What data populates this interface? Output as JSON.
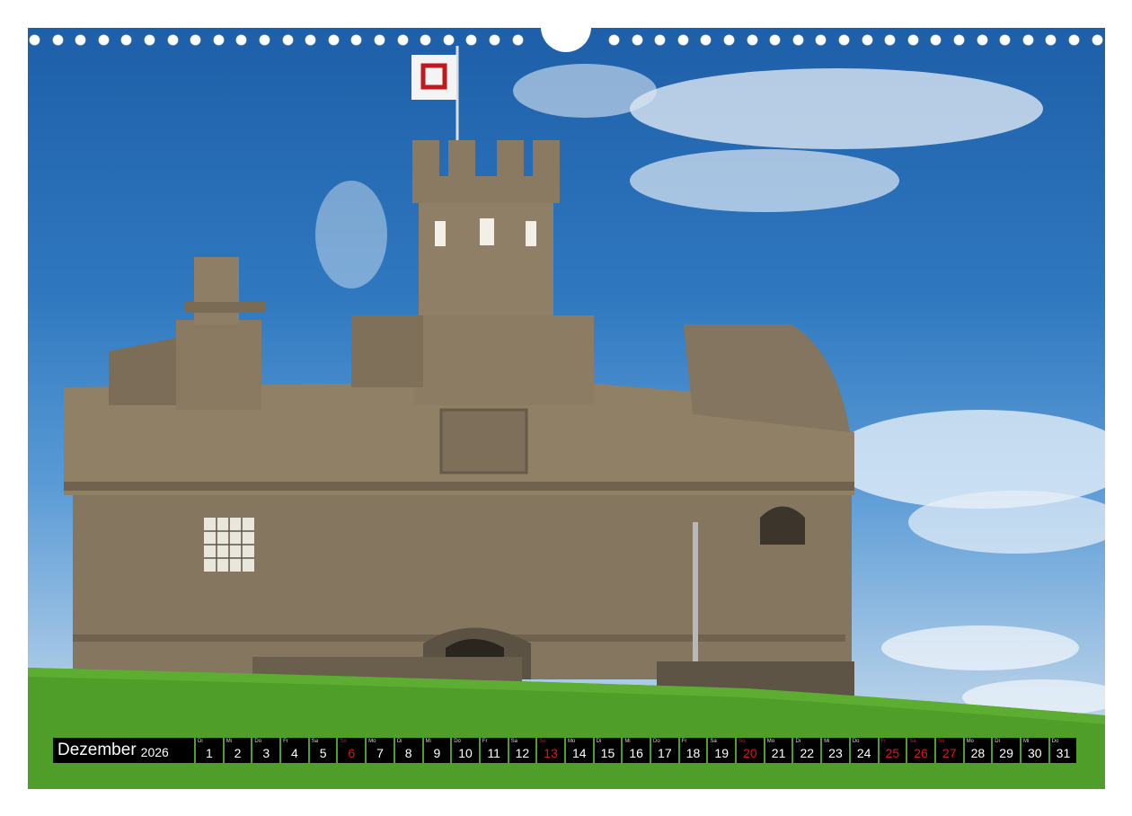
{
  "calendar": {
    "month": "Dezember",
    "year": "2026",
    "days": [
      {
        "wd": "Di",
        "n": "1",
        "we": false
      },
      {
        "wd": "Mi",
        "n": "2",
        "we": false
      },
      {
        "wd": "Do",
        "n": "3",
        "we": false
      },
      {
        "wd": "Fr",
        "n": "4",
        "we": false
      },
      {
        "wd": "Sa",
        "n": "5",
        "we": false
      },
      {
        "wd": "So",
        "n": "6",
        "we": true
      },
      {
        "wd": "Mo",
        "n": "7",
        "we": false
      },
      {
        "wd": "Di",
        "n": "8",
        "we": false
      },
      {
        "wd": "Mi",
        "n": "9",
        "we": false
      },
      {
        "wd": "Do",
        "n": "10",
        "we": false
      },
      {
        "wd": "Fr",
        "n": "11",
        "we": false
      },
      {
        "wd": "Sa",
        "n": "12",
        "we": false
      },
      {
        "wd": "So",
        "n": "13",
        "we": true
      },
      {
        "wd": "Mo",
        "n": "14",
        "we": false
      },
      {
        "wd": "Di",
        "n": "15",
        "we": false
      },
      {
        "wd": "Mi",
        "n": "16",
        "we": false
      },
      {
        "wd": "Do",
        "n": "17",
        "we": false
      },
      {
        "wd": "Fr",
        "n": "18",
        "we": false
      },
      {
        "wd": "Sa",
        "n": "19",
        "we": false
      },
      {
        "wd": "So",
        "n": "20",
        "we": true
      },
      {
        "wd": "Mo",
        "n": "21",
        "we": false
      },
      {
        "wd": "Di",
        "n": "22",
        "we": false
      },
      {
        "wd": "Mi",
        "n": "23",
        "we": false
      },
      {
        "wd": "Do",
        "n": "24",
        "we": false
      },
      {
        "wd": "Fr",
        "n": "25",
        "we": true
      },
      {
        "wd": "Sa",
        "n": "26",
        "we": true
      },
      {
        "wd": "So",
        "n": "27",
        "we": true
      },
      {
        "wd": "Mo",
        "n": "28",
        "we": false
      },
      {
        "wd": "Di",
        "n": "29",
        "we": false
      },
      {
        "wd": "Mi",
        "n": "30",
        "we": false
      },
      {
        "wd": "Do",
        "n": "31",
        "we": false
      }
    ]
  },
  "colors": {
    "holiday": "#e0141e",
    "strip_bg": "#000000",
    "grass": "#4f9e2a",
    "stone": "#8a7b62"
  }
}
